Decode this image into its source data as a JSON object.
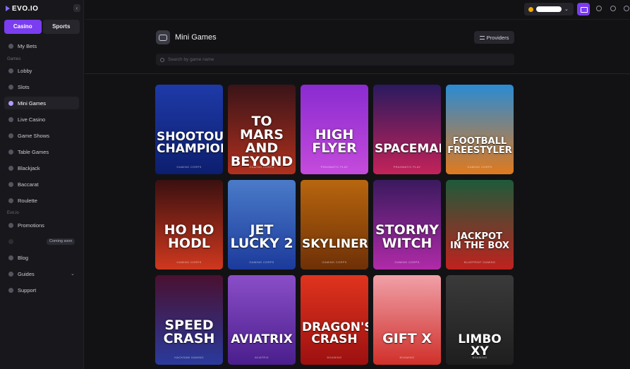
{
  "brand": {
    "logo_text": "EVO.IO",
    "accent": "#7a3df0"
  },
  "sidebar": {
    "collapse_icon": "chevron-left-icon",
    "toggle": [
      {
        "label": "Casino",
        "active": true
      },
      {
        "label": "Sports",
        "active": false
      }
    ],
    "my_bets": "My Bets",
    "section_games": "Games",
    "items": [
      {
        "label": "Lobby",
        "icon": "lobby-icon"
      },
      {
        "label": "Slots",
        "icon": "slots-icon"
      },
      {
        "label": "Mini Games",
        "icon": "gamepad-icon",
        "active": true
      },
      {
        "label": "Live Casino",
        "icon": "live-casino-icon"
      },
      {
        "label": "Game Shows",
        "icon": "game-shows-icon"
      },
      {
        "label": "Table Games",
        "icon": "table-games-icon"
      },
      {
        "label": "Blackjack",
        "icon": "blackjack-icon"
      },
      {
        "label": "Baccarat",
        "icon": "baccarat-icon"
      },
      {
        "label": "Roulette",
        "icon": "roulette-icon"
      }
    ],
    "section_evo": "Evo.io",
    "evo_items": [
      {
        "label": "Promotions",
        "icon": "promotions-icon"
      },
      {
        "label": "Blog",
        "icon": "blog-icon"
      },
      {
        "label": "Guides",
        "icon": "guides-icon"
      },
      {
        "label": "Support",
        "icon": "support-icon"
      }
    ],
    "coming_soon": "Coming soon"
  },
  "topbar": {
    "wallet_icon": "bitcoin-icon",
    "deposit_icon": "wallet-icon",
    "profile_icon": "user-icon",
    "language_icon": "globe-icon",
    "settings_icon": "settings-icon"
  },
  "page": {
    "title": "Mini Games",
    "providers_label": "Providers",
    "search_placeholder": "Search by game name"
  },
  "games": [
    {
      "title": "SHOOTOUT\nCHAMPION",
      "provider": "GAMING CORPS",
      "bg": [
        "#1e3aa8",
        "#0c1e6e"
      ]
    },
    {
      "title": "TO MARS\nAND\nBEYOND",
      "provider": "GAMING CORPS",
      "bg": [
        "#3a1418",
        "#b0301e"
      ]
    },
    {
      "title": "HIGH\nFLYER",
      "provider": "PRAGMATIC PLAY",
      "bg": [
        "#8a2bd0",
        "#c54bdc"
      ]
    },
    {
      "title": "SPACEMAN",
      "provider": "PRAGMATIC PLAY",
      "bg": [
        "#2a1a5e",
        "#c4225a"
      ]
    },
    {
      "title": "FOOTBALL\nFREESTYLER",
      "provider": "GAMING CORPS",
      "bg": [
        "#2a8bd4",
        "#e07a1e"
      ]
    },
    {
      "title": "HO HO\nHODL",
      "provider": "GAMING CORPS",
      "bg": [
        "#3a1010",
        "#d0381e"
      ]
    },
    {
      "title": "JET\nLUCKY 2",
      "provider": "GAMING CORPS",
      "bg": [
        "#4a7bc8",
        "#1c3a9c"
      ]
    },
    {
      "title": "SKYLINER",
      "provider": "GAMING CORPS",
      "bg": [
        "#b8660e",
        "#6e3006"
      ]
    },
    {
      "title": "STORMY\nWITCH",
      "provider": "GAMING CORPS",
      "bg": [
        "#3a1a5e",
        "#b02aa8"
      ]
    },
    {
      "title": "JACKPOT\nIN THE BOX",
      "provider": "BLUEPRINT GAMING",
      "bg": [
        "#1e5a3a",
        "#c0221e"
      ]
    },
    {
      "title": "SPEED\nCRASH",
      "provider": "HACKSAW GAMING",
      "bg": [
        "#4a1030",
        "#2a3a9c"
      ]
    },
    {
      "title": "AVIATRIX",
      "provider": "AVIATRIX",
      "bg": [
        "#8a4ec8",
        "#4a1e8c"
      ]
    },
    {
      "title": "DRAGON'S\nCRASH",
      "provider": "BGAMING",
      "bg": [
        "#e0341e",
        "#9c1010"
      ]
    },
    {
      "title": "GIFT X",
      "provider": "BGAMING",
      "bg": [
        "#f0a0a8",
        "#d0302a"
      ]
    },
    {
      "title": "LIMBO XY",
      "provider": "BGAMING",
      "bg": [
        "#3a3a3a",
        "#1e1e1e"
      ]
    }
  ]
}
